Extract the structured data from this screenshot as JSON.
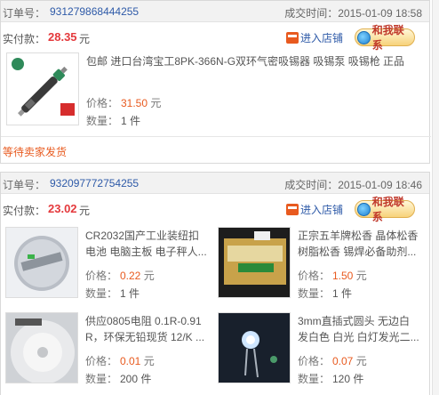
{
  "order1": {
    "order_label": "订单号：",
    "order_number": "931279868444255",
    "time_label": "成交时间：",
    "time": "2015-01-09 18:58",
    "paid_label": "实付款：",
    "paid_amount": "28.35",
    "currency": "元",
    "enter_shop": "进入店铺",
    "contact": "和我联系",
    "items": [
      {
        "title": "包邮 进口台湾宝工8PK-366N-G双环气密吸锡器 吸锡泵 吸锡枪 正品",
        "price_label": "价格：",
        "price": "31.50",
        "price_unit": "元",
        "qty_label": "数量：",
        "qty": "1 件"
      }
    ],
    "status": "等待卖家发货"
  },
  "order2": {
    "order_label": "订单号：",
    "order_number": "932097772754255",
    "time_label": "成交时间：",
    "time": "2015-01-09 18:46",
    "paid_label": "实付款：",
    "paid_amount": "23.02",
    "currency": "元",
    "enter_shop": "进入店铺",
    "contact": "和我联系",
    "items": [
      {
        "title_line1": "CR2032国产工业装纽扣",
        "title_line2": "电池 电脑主板 电子秤人...",
        "price_label": "价格：",
        "price": "0.22",
        "price_unit": "元",
        "qty_label": "数量：",
        "qty": "1 件"
      },
      {
        "title_line1": "正宗五羊牌松香 晶体松香",
        "title_line2": "树脂松香 锡焊必备助剂...",
        "price_label": "价格：",
        "price": "1.50",
        "price_unit": "元",
        "qty_label": "数量：",
        "qty": "1 件"
      },
      {
        "title_line1": "供应0805电阻 0.1R-0.91",
        "title_line2": "R，环保无铅现货 12/K ...",
        "price_label": "价格：",
        "price": "0.01",
        "price_unit": "元",
        "qty_label": "数量：",
        "qty": "200 件"
      },
      {
        "title_line1": "3mm直插式圆头 无边白",
        "title_line2": "发白色 白光 白灯发光二...",
        "price_label": "价格：",
        "price": "0.07",
        "price_unit": "元",
        "qty_label": "数量：",
        "qty": "120 件"
      }
    ]
  },
  "colors": {
    "link_blue": "#2e5aa8",
    "price_orange": "#e85a1f",
    "paid_red": "#e4393c"
  }
}
